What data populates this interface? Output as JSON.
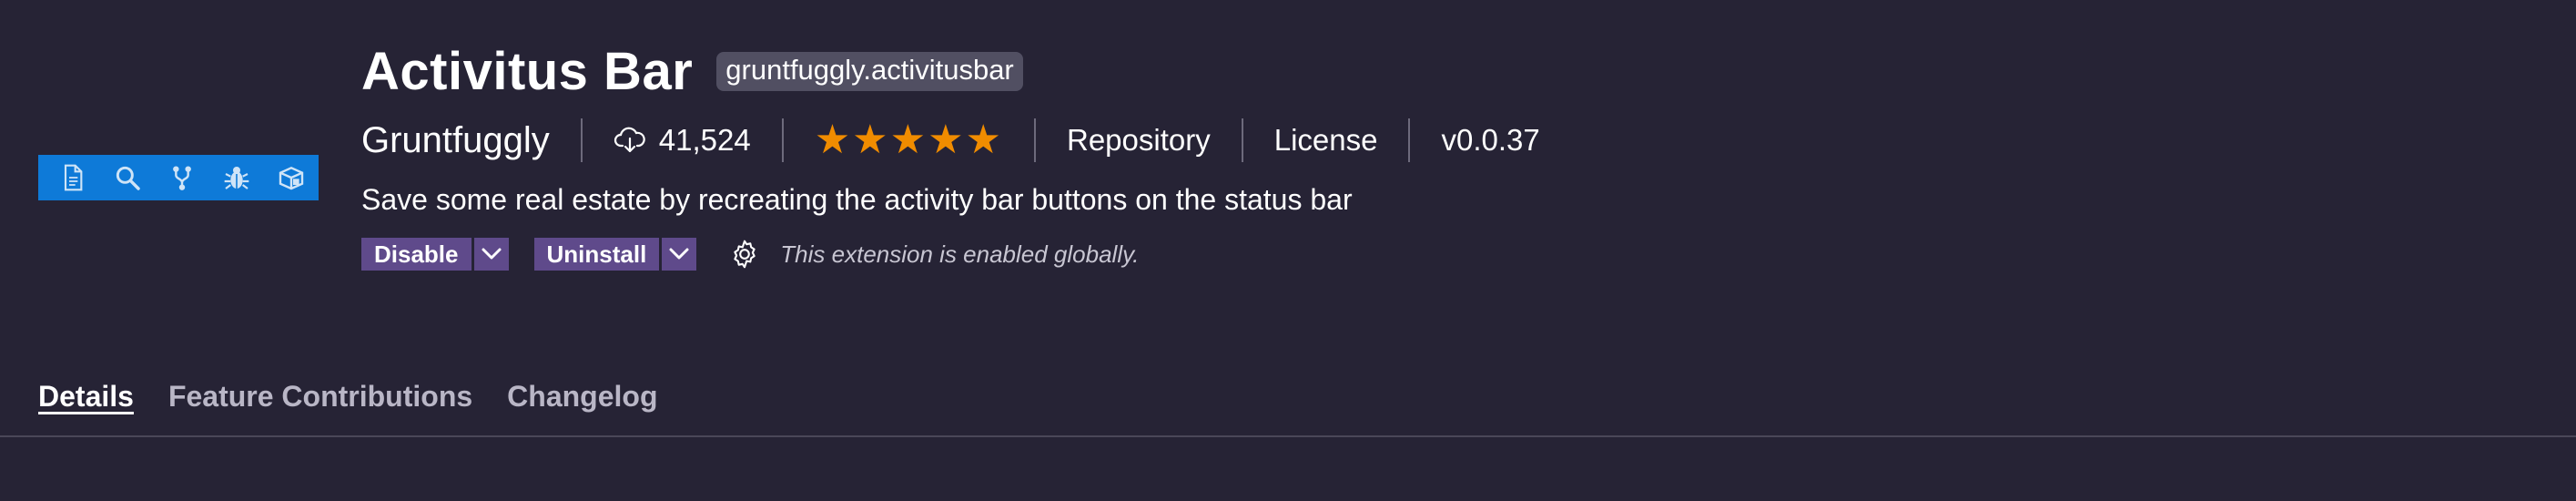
{
  "extension": {
    "name": "Activitus Bar",
    "id": "gruntfuggly.activitusbar",
    "publisher": "Gruntfuggly",
    "installs": "41,524",
    "rating": 5,
    "links": {
      "repository": "Repository",
      "license": "License"
    },
    "version": "v0.0.37",
    "description": "Save some real estate by recreating the activity bar buttons on the status bar"
  },
  "actions": {
    "disable_label": "Disable",
    "uninstall_label": "Uninstall",
    "status_text": "This extension is enabled globally."
  },
  "tabs": [
    {
      "label": "Details",
      "active": true
    },
    {
      "label": "Feature Contributions",
      "active": false
    },
    {
      "label": "Changelog",
      "active": false
    }
  ],
  "logo": {
    "background": "#0e7ad8",
    "icons": [
      "file-icon",
      "search-icon",
      "source-control-icon",
      "debug-icon",
      "extensions-icon"
    ]
  },
  "colors": {
    "background": "#262335",
    "button": "#5f4a8b",
    "star": "#f08c00"
  }
}
